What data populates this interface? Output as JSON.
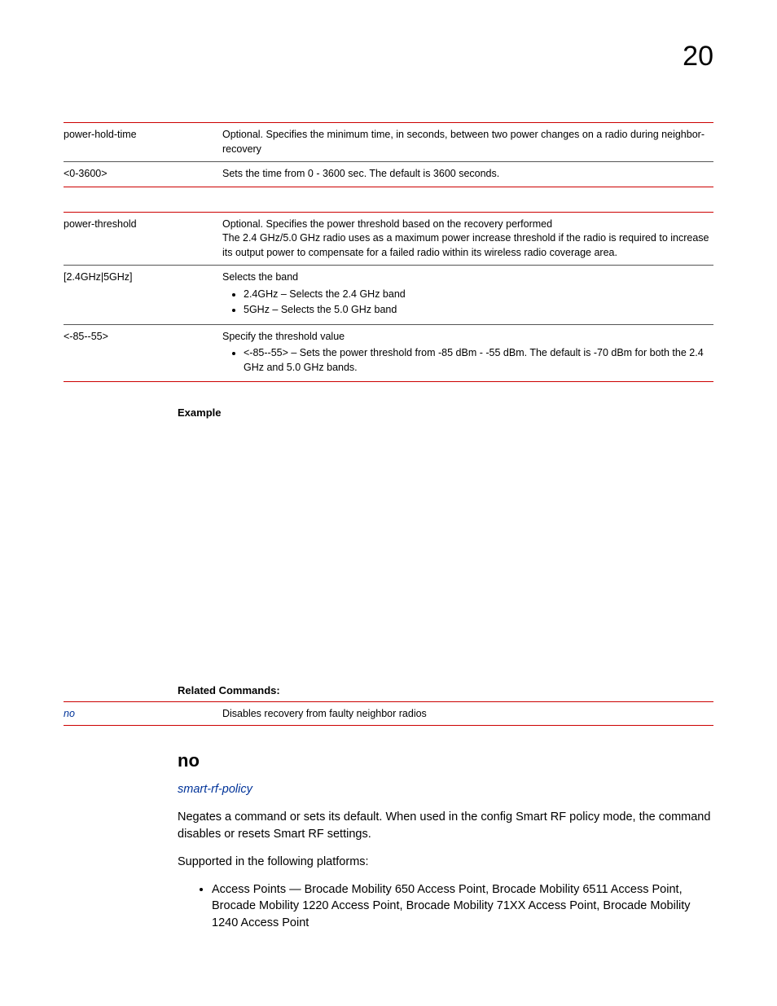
{
  "chapter": "20",
  "table1": {
    "rows": [
      {
        "param": "power-hold-time",
        "desc": "Optional. Specifies the minimum time, in seconds, between two power changes on a radio during neighbor-recovery"
      },
      {
        "param": "<0-3600>",
        "desc": "Sets the time from 0 - 3600 sec. The default is 3600 seconds."
      }
    ]
  },
  "table2": {
    "rows": [
      {
        "param": "power-threshold",
        "desc_lines": [
          "Optional. Specifies the power threshold based on the recovery performed",
          "The 2.4 GHz/5.0 GHz radio uses as a maximum power increase threshold if the radio is required to increase its output power to compensate for a failed radio within its wireless radio coverage area."
        ]
      },
      {
        "param": "[2.4GHz|5GHz]",
        "desc_intro": "Selects the band",
        "bullets": [
          "2.4GHz – Selects the 2.4 GHz band",
          "5GHz – Selects the 5.0 GHz band"
        ]
      },
      {
        "param": "<-85--55>",
        "desc_intro": "Specify the threshold value",
        "bullets": [
          "<-85--55> – Sets the power threshold from -85 dBm - -55 dBm. The default is -70 dBm for both the 2.4 GHz and 5.0 GHz bands."
        ]
      }
    ]
  },
  "example_label": "Example",
  "related_label": "Related Commands:",
  "related": {
    "cmd": "no",
    "desc": "Disables recovery from faulty neighbor radios"
  },
  "no_section": {
    "heading": "no",
    "context_link": "smart-rf-policy",
    "para1": "Negates a command or sets its default. When used in the config Smart RF policy mode, the command disables or resets Smart RF settings.",
    "para2": "Supported in the following platforms:",
    "bullet": "Access Points — Brocade Mobility 650 Access Point, Brocade Mobility 6511 Access Point, Brocade Mobility 1220 Access Point, Brocade Mobility 71XX Access Point, Brocade Mobility 1240 Access Point"
  }
}
